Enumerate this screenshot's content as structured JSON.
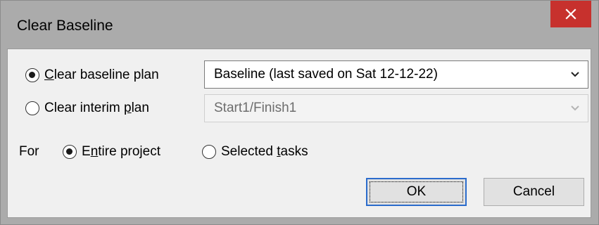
{
  "dialog": {
    "title": "Clear Baseline",
    "close_icon": "close-x-icon"
  },
  "clear_baseline_plan": {
    "label_prefix": "",
    "label_mnemonic": "C",
    "label_rest": "lear baseline plan",
    "checked": true,
    "selected_value": "Baseline (last saved on Sat 12-12-22)",
    "dropdown_icon": "chevron-down-icon"
  },
  "clear_interim_plan": {
    "label_prefix": "Clear interim ",
    "label_mnemonic": "p",
    "label_rest": "lan",
    "checked": false,
    "selected_value": "Start1/Finish1",
    "disabled": true,
    "dropdown_icon": "chevron-down-icon"
  },
  "for_scope": {
    "label": "For",
    "entire_project": {
      "label_prefix": "E",
      "label_mnemonic": "n",
      "label_rest": "tire project",
      "checked": true
    },
    "selected_tasks": {
      "label_prefix": "Selected ",
      "label_mnemonic": "t",
      "label_rest": "asks",
      "checked": false
    }
  },
  "buttons": {
    "ok": "OK",
    "cancel": "Cancel"
  },
  "colors": {
    "close_button_bg": "#c7312d",
    "frame_bg": "#ababab",
    "client_bg": "#f0f0f0",
    "default_button_border": "#2b6ccc"
  }
}
